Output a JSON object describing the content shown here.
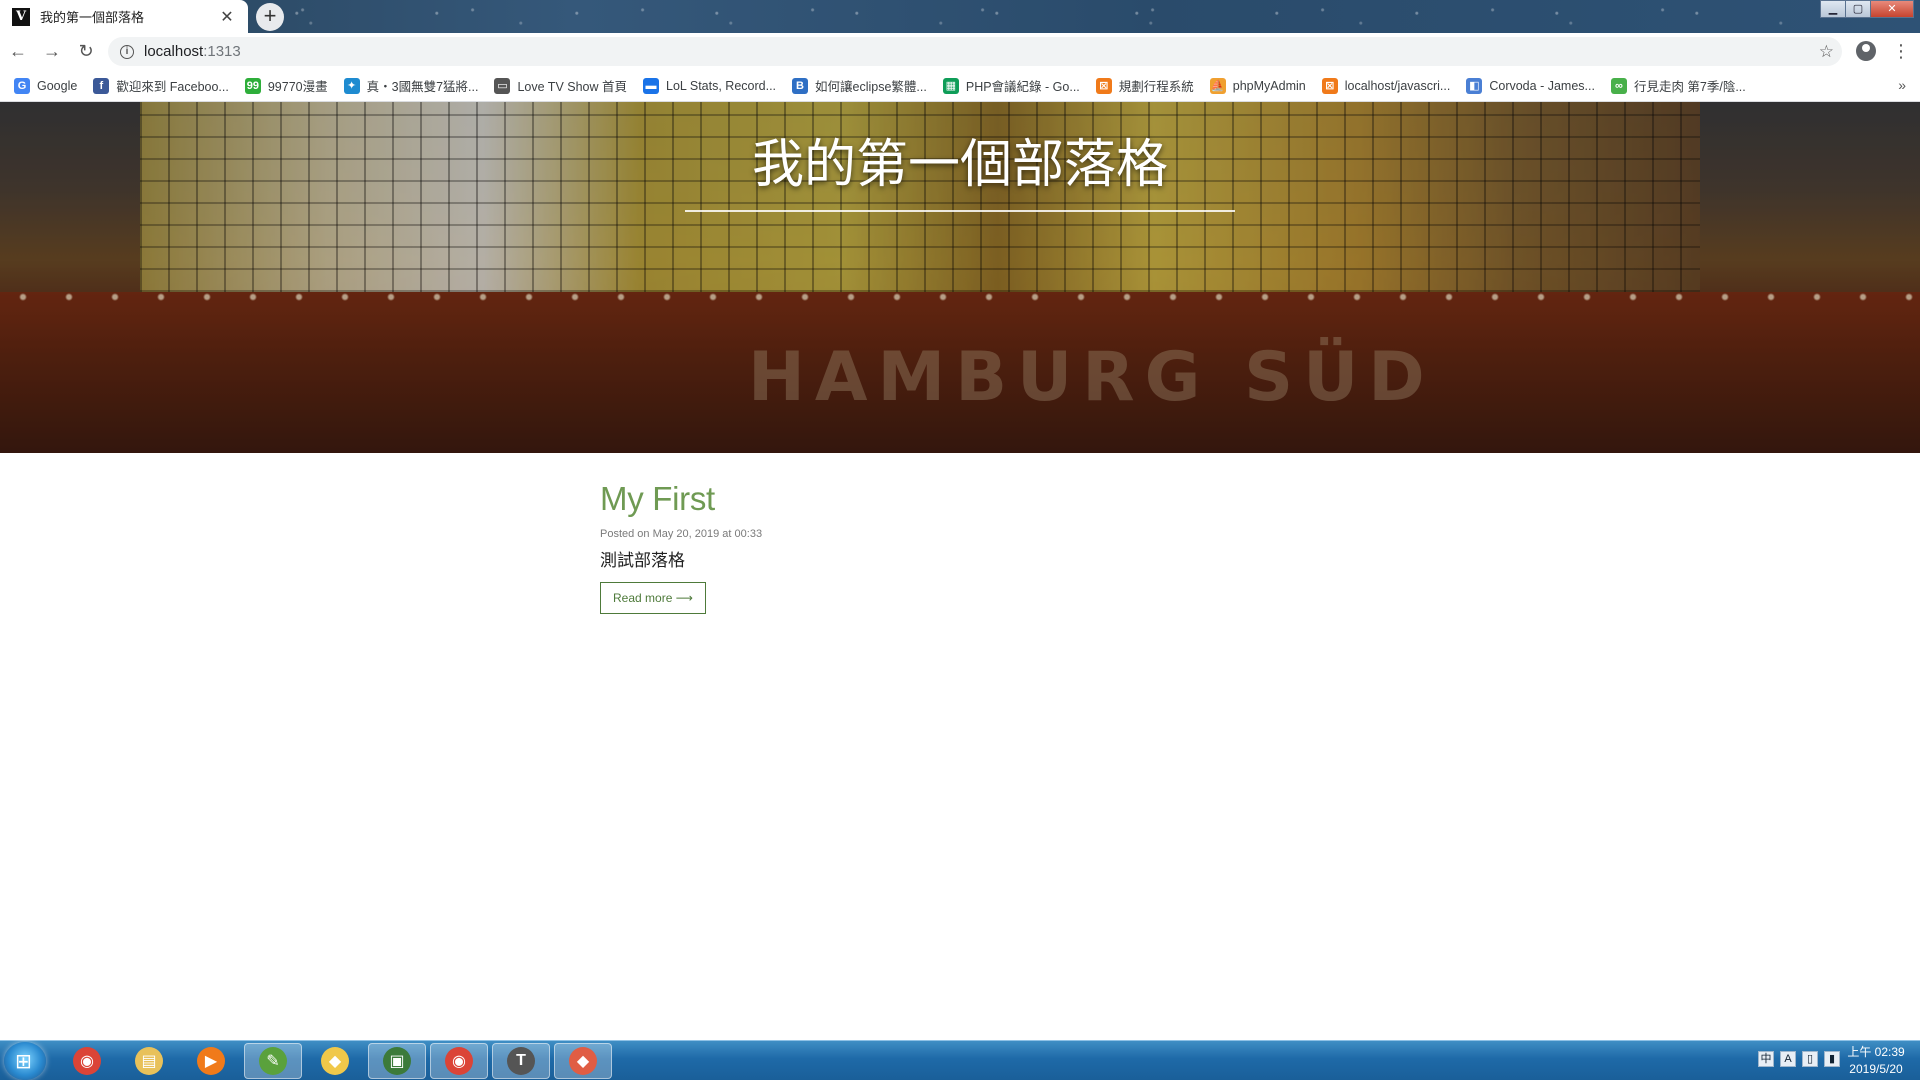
{
  "browser": {
    "tab_title": "我的第一個部落格",
    "tab_favicon": "V",
    "url_host": "localhost",
    "url_port": ":1313"
  },
  "bookmarks": [
    {
      "label": "Google",
      "icon": "google-icon",
      "color": "#4285f4",
      "glyph": "G"
    },
    {
      "label": "歡迎來到 Faceboo...",
      "icon": "facebook-icon",
      "color": "#3b5998",
      "glyph": "f"
    },
    {
      "label": "99770漫畫",
      "icon": "manga-icon",
      "color": "#2eae3a",
      "glyph": "99"
    },
    {
      "label": "真・3國無雙7猛將...",
      "icon": "game-icon",
      "color": "#1e8bd0",
      "glyph": "✦"
    },
    {
      "label": "Love TV Show 首頁",
      "icon": "tv-icon",
      "color": "#555555",
      "glyph": "▭"
    },
    {
      "label": "LoL Stats, Record...",
      "icon": "lol-icon",
      "color": "#1a73e8",
      "glyph": "▬"
    },
    {
      "label": "如何讓eclipse繁體...",
      "icon": "blog-icon",
      "color": "#2f6fc4",
      "glyph": "B"
    },
    {
      "label": "PHP會議紀錄 - Go...",
      "icon": "sheets-icon",
      "color": "#0f9d58",
      "glyph": "▦"
    },
    {
      "label": "規劃行程系統",
      "icon": "xampp-icon",
      "color": "#f07a1a",
      "glyph": "⊠"
    },
    {
      "label": "phpMyAdmin",
      "icon": "phpmyadmin-icon",
      "color": "#f0a030",
      "glyph": "⛵"
    },
    {
      "label": "localhost/javascri...",
      "icon": "xampp-icon",
      "color": "#f07a1a",
      "glyph": "⊠"
    },
    {
      "label": "Corvoda - James...",
      "icon": "page-icon",
      "color": "#4a7fd4",
      "glyph": "◧"
    },
    {
      "label": "行見走肉 第7季/陰...",
      "icon": "link-icon",
      "color": "#48b04a",
      "glyph": "∞"
    }
  ],
  "page": {
    "site_title": "我的第一個部落格",
    "hull_text": "HAMBURG SÜD",
    "post": {
      "title": "My First",
      "meta": "Posted on May 20, 2019 at 00:33",
      "summary": "測試部落格",
      "read_more": "Read more ⟶"
    }
  },
  "taskbar": {
    "apps": [
      {
        "name": "chrome-icon",
        "glyph": "◉",
        "color": "#db4437",
        "active": false
      },
      {
        "name": "file-explorer-icon",
        "glyph": "▤",
        "color": "#e8c15a",
        "active": false
      },
      {
        "name": "media-player-icon",
        "glyph": "▶",
        "color": "#f07a1a",
        "active": false
      },
      {
        "name": "notepad-icon",
        "glyph": "✎",
        "color": "#5aa13c",
        "active": true
      },
      {
        "name": "folder-icon",
        "glyph": "◆",
        "color": "#f0c84a",
        "active": false
      },
      {
        "name": "monitor-icon",
        "glyph": "▣",
        "color": "#3c7a3a",
        "active": true
      },
      {
        "name": "chrome-icon",
        "glyph": "◉",
        "color": "#db4437",
        "active": true
      },
      {
        "name": "typora-icon",
        "glyph": "T",
        "color": "#555555",
        "active": true
      },
      {
        "name": "git-icon",
        "glyph": "◆",
        "color": "#e05d44",
        "active": true
      }
    ],
    "clock_time": "上午 02:39",
    "clock_date": "2019/5/20"
  },
  "colors": {
    "post_title": "#6f9a53",
    "button_border": "#4e7a3a"
  }
}
